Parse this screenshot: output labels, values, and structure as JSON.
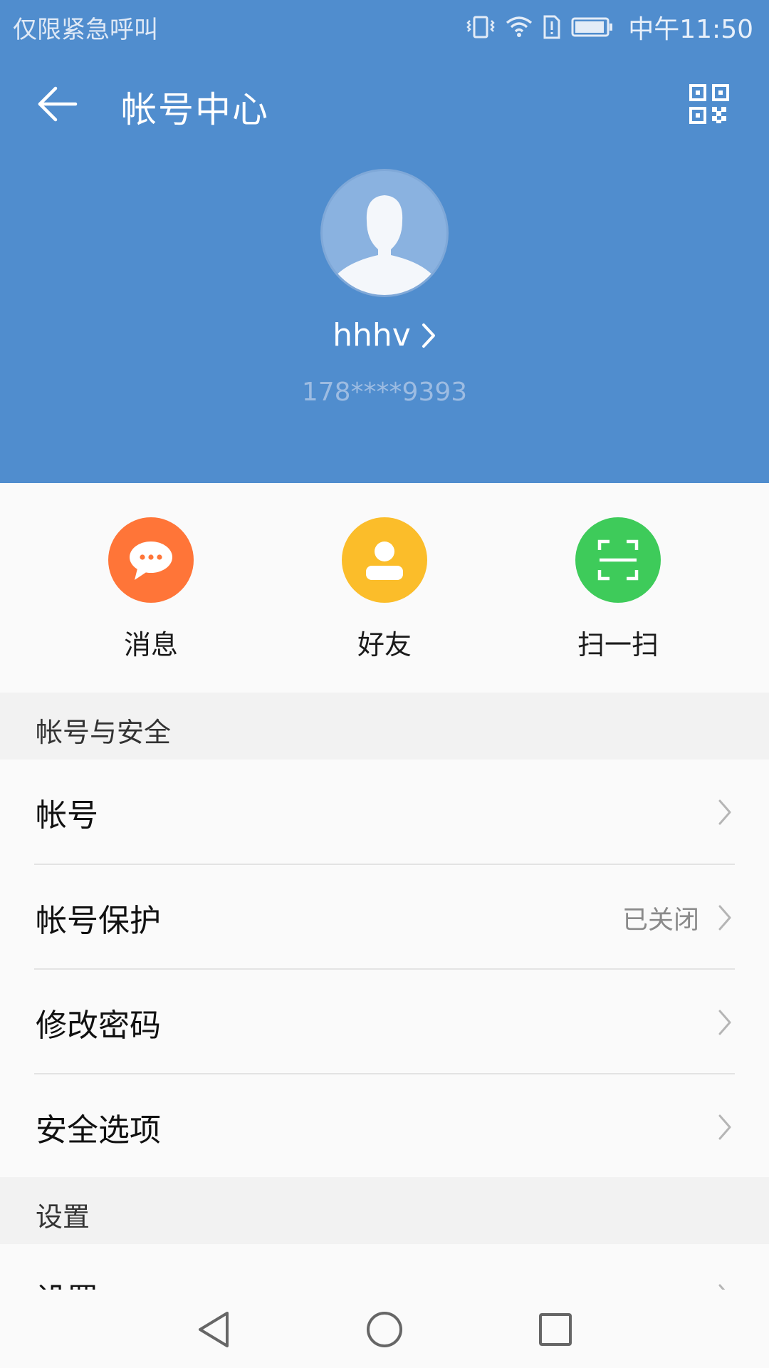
{
  "status_bar": {
    "carrier_text": "仅限紧急呼叫",
    "time": "中午11:50",
    "icons": [
      "vibrate-icon",
      "wifi-icon",
      "sim-alert-icon",
      "battery-icon"
    ]
  },
  "app_bar": {
    "title": "帐号中心",
    "back_icon": "arrow-left-icon",
    "qr_icon": "qr-code-icon"
  },
  "profile": {
    "username": "hhhv",
    "phone": "178****9393"
  },
  "quick_actions": [
    {
      "label": "消息",
      "icon": "chat-bubble-icon",
      "color": "#ff7538"
    },
    {
      "label": "好友",
      "icon": "person-icon",
      "color": "#fbbd2a"
    },
    {
      "label": "扫一扫",
      "icon": "scan-icon",
      "color": "#3ecb5a"
    }
  ],
  "sections": [
    {
      "title": "帐号与安全",
      "items": [
        {
          "label": "帐号",
          "value": ""
        },
        {
          "label": "帐号保护",
          "value": "已关闭"
        },
        {
          "label": "修改密码",
          "value": ""
        },
        {
          "label": "安全选项",
          "value": ""
        }
      ]
    },
    {
      "title": "设置",
      "items": [
        {
          "label": "设置",
          "value": ""
        }
      ]
    }
  ],
  "colors": {
    "header_blue": "#508dce",
    "section_bg": "#f2f2f2"
  },
  "nav_bar": {
    "icons": [
      "back-triangle-icon",
      "home-circle-icon",
      "recents-square-icon"
    ]
  }
}
